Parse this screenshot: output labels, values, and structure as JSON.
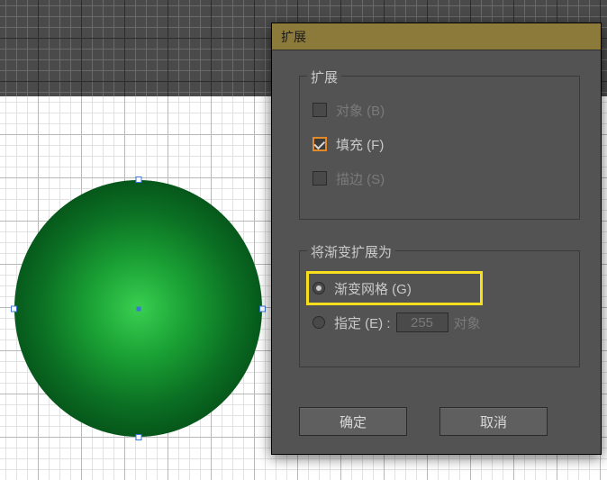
{
  "dialog": {
    "title": "扩展",
    "groups": {
      "expand": {
        "label": "扩展",
        "object": {
          "label": "对象 (B)",
          "checked": false,
          "enabled": false
        },
        "fill": {
          "label": "填充 (F)",
          "checked": true,
          "enabled": true
        },
        "stroke": {
          "label": "描边 (S)",
          "checked": false,
          "enabled": false
        }
      },
      "gradient": {
        "label": "将渐变扩展为",
        "mesh": {
          "label": "渐变网格 (G)",
          "selected": true
        },
        "specify": {
          "label": "指定 (E) :",
          "selected": false,
          "value": "255",
          "suffix": "对象"
        }
      }
    },
    "buttons": {
      "ok": "确定",
      "cancel": "取消"
    }
  },
  "canvas": {
    "shape": "ellipse",
    "fill": "radial-green-gradient",
    "selected": true
  }
}
